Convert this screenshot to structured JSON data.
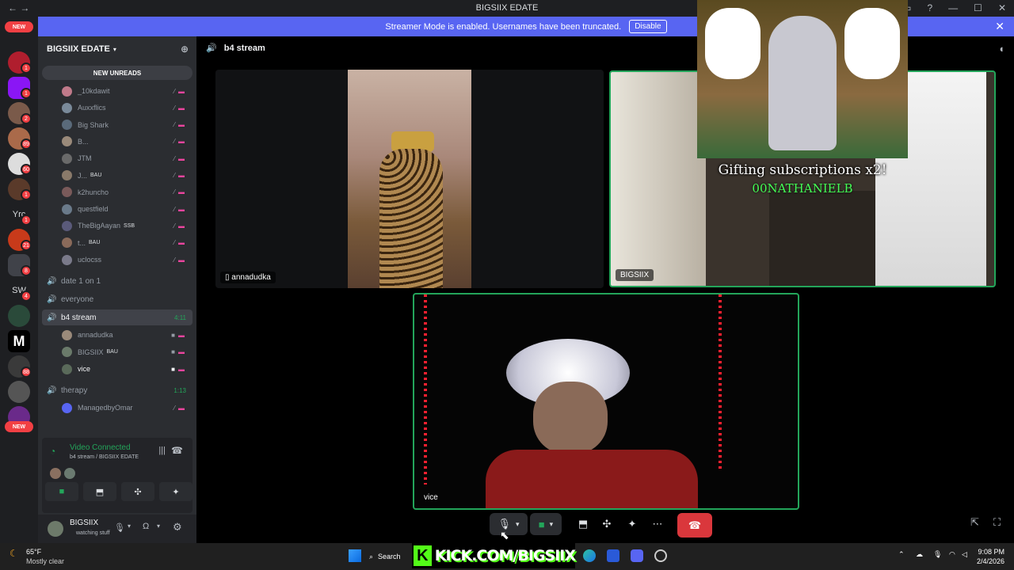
{
  "window": {
    "title": "BIGSIIX EDATE"
  },
  "banner": {
    "text": "Streamer Mode is enabled. Usernames have been truncated.",
    "disable_label": "Disable"
  },
  "rail": {
    "new_top": "NEW",
    "new_bottom": "NEW",
    "badges": [
      "1",
      "1",
      "2",
      "89",
      "60",
      "1",
      "1",
      "21",
      "8",
      "4",
      "88"
    ],
    "text_servers": [
      "Yrc",
      "SW",
      "M"
    ]
  },
  "sidebar": {
    "guild_name": "BIGSIIX EDATE",
    "new_unreads": "NEW UNREADS",
    "members_top": [
      {
        "name": "_10kdawit",
        "tag": ""
      },
      {
        "name": "Auxxflics",
        "tag": ""
      },
      {
        "name": "Big Shark",
        "tag": ""
      },
      {
        "name": "B...",
        "tag": ""
      },
      {
        "name": "JTM",
        "tag": ""
      },
      {
        "name": "J...",
        "tag": "BAU"
      },
      {
        "name": "k2huncho",
        "tag": ""
      },
      {
        "name": "questfield",
        "tag": ""
      },
      {
        "name": "TheBigAayan",
        "tag": "SSB"
      },
      {
        "name": "t...",
        "tag": "BAU"
      },
      {
        "name": "uclocss",
        "tag": ""
      }
    ],
    "channels": {
      "date": "date 1 on 1",
      "everyone": "everyone",
      "b4": {
        "name": "b4 stream",
        "time": "4:11"
      },
      "therapy": {
        "name": "therapy",
        "time": "1:13"
      }
    },
    "b4_members": [
      {
        "name": "annadudka",
        "tag": ""
      },
      {
        "name": "BIGSIIX",
        "tag": "BAU"
      },
      {
        "name": "vice",
        "tag": ""
      }
    ],
    "therapy_members": [
      {
        "name": "ManagedbyOmar"
      }
    ]
  },
  "voice_panel": {
    "status": "Video Connected",
    "location": "b4 stream / BIGSIIX EDATE"
  },
  "user": {
    "name": "BIGSIIX",
    "status": "watching stuff"
  },
  "main": {
    "channel": "b4 stream",
    "tiles": [
      {
        "name": "annadudka"
      },
      {
        "name": "BIGSIIX"
      },
      {
        "name": "vice"
      }
    ]
  },
  "overlay": {
    "gift_text": "Gifting subscriptions x2!",
    "gifter": "00NATHANIELB"
  },
  "taskbar": {
    "weather_temp": "65°F",
    "weather_desc": "Mostly clear",
    "search": "Search",
    "kick_text": "KICK.COM/BIGSIIX",
    "time": "9:08 PM",
    "date": "2/4/2026"
  },
  "colors": {
    "blurple": "#5865f2",
    "green": "#23a55a",
    "red": "#da373c",
    "kick_green": "#53fc18"
  }
}
